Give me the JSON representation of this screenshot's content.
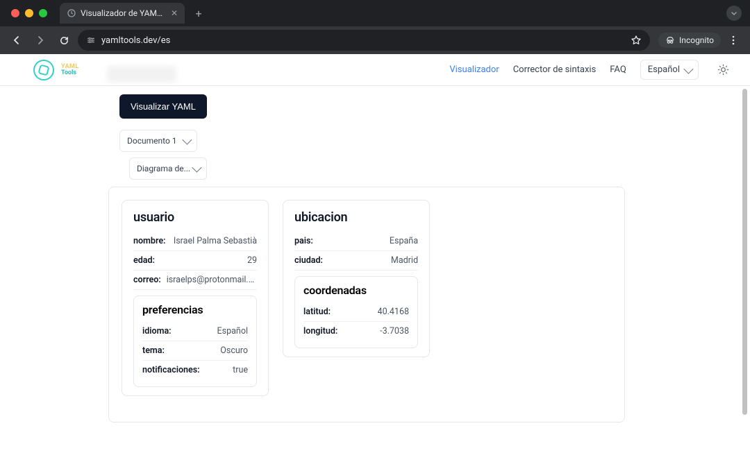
{
  "browser": {
    "tab_title": "Visualizador de YAML - Ver y",
    "url": "yamltools.dev/es",
    "incognito_label": "Incognito"
  },
  "site": {
    "brand_line1": "YAML",
    "brand_line2": "Tools",
    "nav": {
      "visualizer": "Visualizador",
      "syntax": "Corrector de sintaxis",
      "faq": "FAQ"
    },
    "language": "Español"
  },
  "controls": {
    "visualize_button": "Visualizar YAML",
    "document_select": "Documento 1",
    "view_select": "Diagrama de..."
  },
  "cards": {
    "usuario": {
      "title": "usuario",
      "fields": {
        "nombre_k": "nombre:",
        "nombre_v": "Israel Palma Sebastià",
        "edad_k": "edad:",
        "edad_v": "29",
        "correo_k": "correo:",
        "correo_v": "israelps@protonmail.com"
      },
      "preferencias": {
        "title": "preferencias",
        "idioma_k": "idioma:",
        "idioma_v": "Español",
        "tema_k": "tema:",
        "tema_v": "Oscuro",
        "notif_k": "notificaciones:",
        "notif_v": "true"
      }
    },
    "ubicacion": {
      "title": "ubicacion",
      "fields": {
        "pais_k": "pais:",
        "pais_v": "España",
        "ciudad_k": "ciudad:",
        "ciudad_v": "Madrid"
      },
      "coordenadas": {
        "title": "coordenadas",
        "lat_k": "latitud:",
        "lat_v": "40.4168",
        "lon_k": "longitud:",
        "lon_v": "-3.7038"
      }
    }
  }
}
